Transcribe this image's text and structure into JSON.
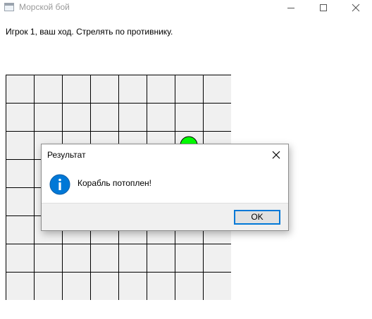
{
  "window": {
    "title": "Морской бой",
    "controls": {
      "minimize_icon": "minimize-icon",
      "maximize_icon": "maximize-icon",
      "close_icon": "close-icon"
    }
  },
  "status_text": "Игрок 1, ваш ход. Стрелять по противнику.",
  "board": {
    "rows": 8,
    "cols": 8,
    "cell_color": "#f0f0f0",
    "line_color": "#000000",
    "markers": [
      {
        "row": 2,
        "col": 6,
        "color": "#00ff00",
        "kind": "hit"
      }
    ]
  },
  "dialog": {
    "title": "Результат",
    "icon": "info-icon",
    "icon_color": "#0078d7",
    "message": "Корабль потоплен!",
    "ok_label": "OK"
  }
}
